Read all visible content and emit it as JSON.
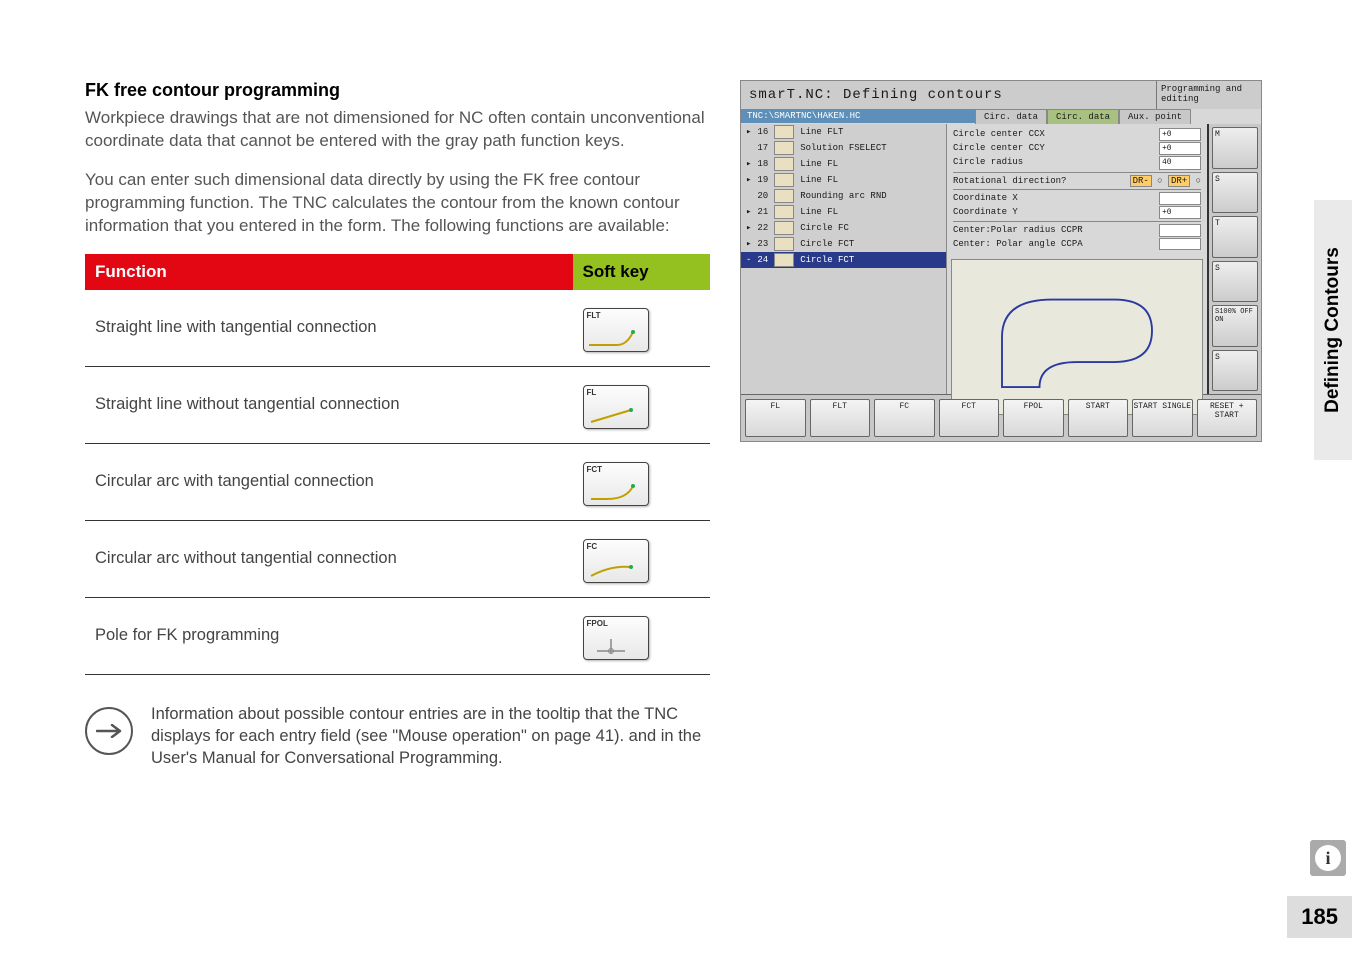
{
  "heading": "FK free contour programming",
  "para1": "Workpiece drawings that are not dimensioned for NC often contain unconventional coordinate data that cannot be entered with the gray path function keys.",
  "para2": "You can enter such dimensional data directly by using the FK free contour programming function. The TNC calculates the contour from the known contour information that you entered in the form. The following functions are available:",
  "table": {
    "head_func": "Function",
    "head_soft": "Soft key",
    "rows": [
      {
        "label": "Straight line with tangential connection",
        "key": "FLT"
      },
      {
        "label": "Straight line without tangential connection",
        "key": "FL"
      },
      {
        "label": "Circular arc with tangential connection",
        "key": "FCT"
      },
      {
        "label": "Circular arc without tangential connection",
        "key": "FC"
      },
      {
        "label": "Pole for FK programming",
        "key": "FPOL"
      }
    ]
  },
  "note": "Information about possible contour entries are in the tooltip that the TNC displays for each entry field (see \"Mouse operation\" on page 41). and in the User's Manual for Conversational Programming.",
  "side_tab": "Defining Contours",
  "page_num": "185",
  "info_icon": "i",
  "cnc": {
    "title": "smarT.NC: Defining contours",
    "mode": "Programming and editing",
    "path": "TNC:\\SMARTNC\\HAKEN.HC",
    "tree": [
      {
        "n": "16",
        "t": "Line FLT"
      },
      {
        "n": "17",
        "t": "Solution FSELECT"
      },
      {
        "n": "18",
        "t": "Line FL"
      },
      {
        "n": "19",
        "t": "Line FL"
      },
      {
        "n": "20",
        "t": "Rounding arc RND"
      },
      {
        "n": "21",
        "t": "Line FL"
      },
      {
        "n": "22",
        "t": "Circle FC"
      },
      {
        "n": "23",
        "t": "Circle FCT"
      },
      {
        "n": "24",
        "t": "Circle FCT",
        "sel": true
      }
    ],
    "tabs": [
      "Circ. data",
      "Circ. data",
      "Aux. point"
    ],
    "fields": {
      "ccx_label": "Circle center CCX",
      "ccx": "+0",
      "ccy_label": "Circle center CCY",
      "ccy": "+0",
      "cr_label": "Circle radius",
      "cr": "40",
      "rot_label": "Rotational direction?",
      "rot_opt1": "DR-",
      "rot_opt2": "DR+",
      "cx_label": "Coordinate X",
      "cy_label": "Coordinate Y",
      "cy": "+0",
      "ccpr_label": "Center:Polar radius CCPR",
      "ccpa_label": "Center: Polar angle CCPA"
    },
    "sidebtns": [
      "M",
      "S",
      "T",
      "S",
      "S100% OFF ON",
      "S"
    ],
    "bottom": [
      "FL",
      "FLT",
      "FC",
      "FCT",
      "FPOL",
      "START",
      "START SINGLE",
      "RESET + START"
    ]
  }
}
